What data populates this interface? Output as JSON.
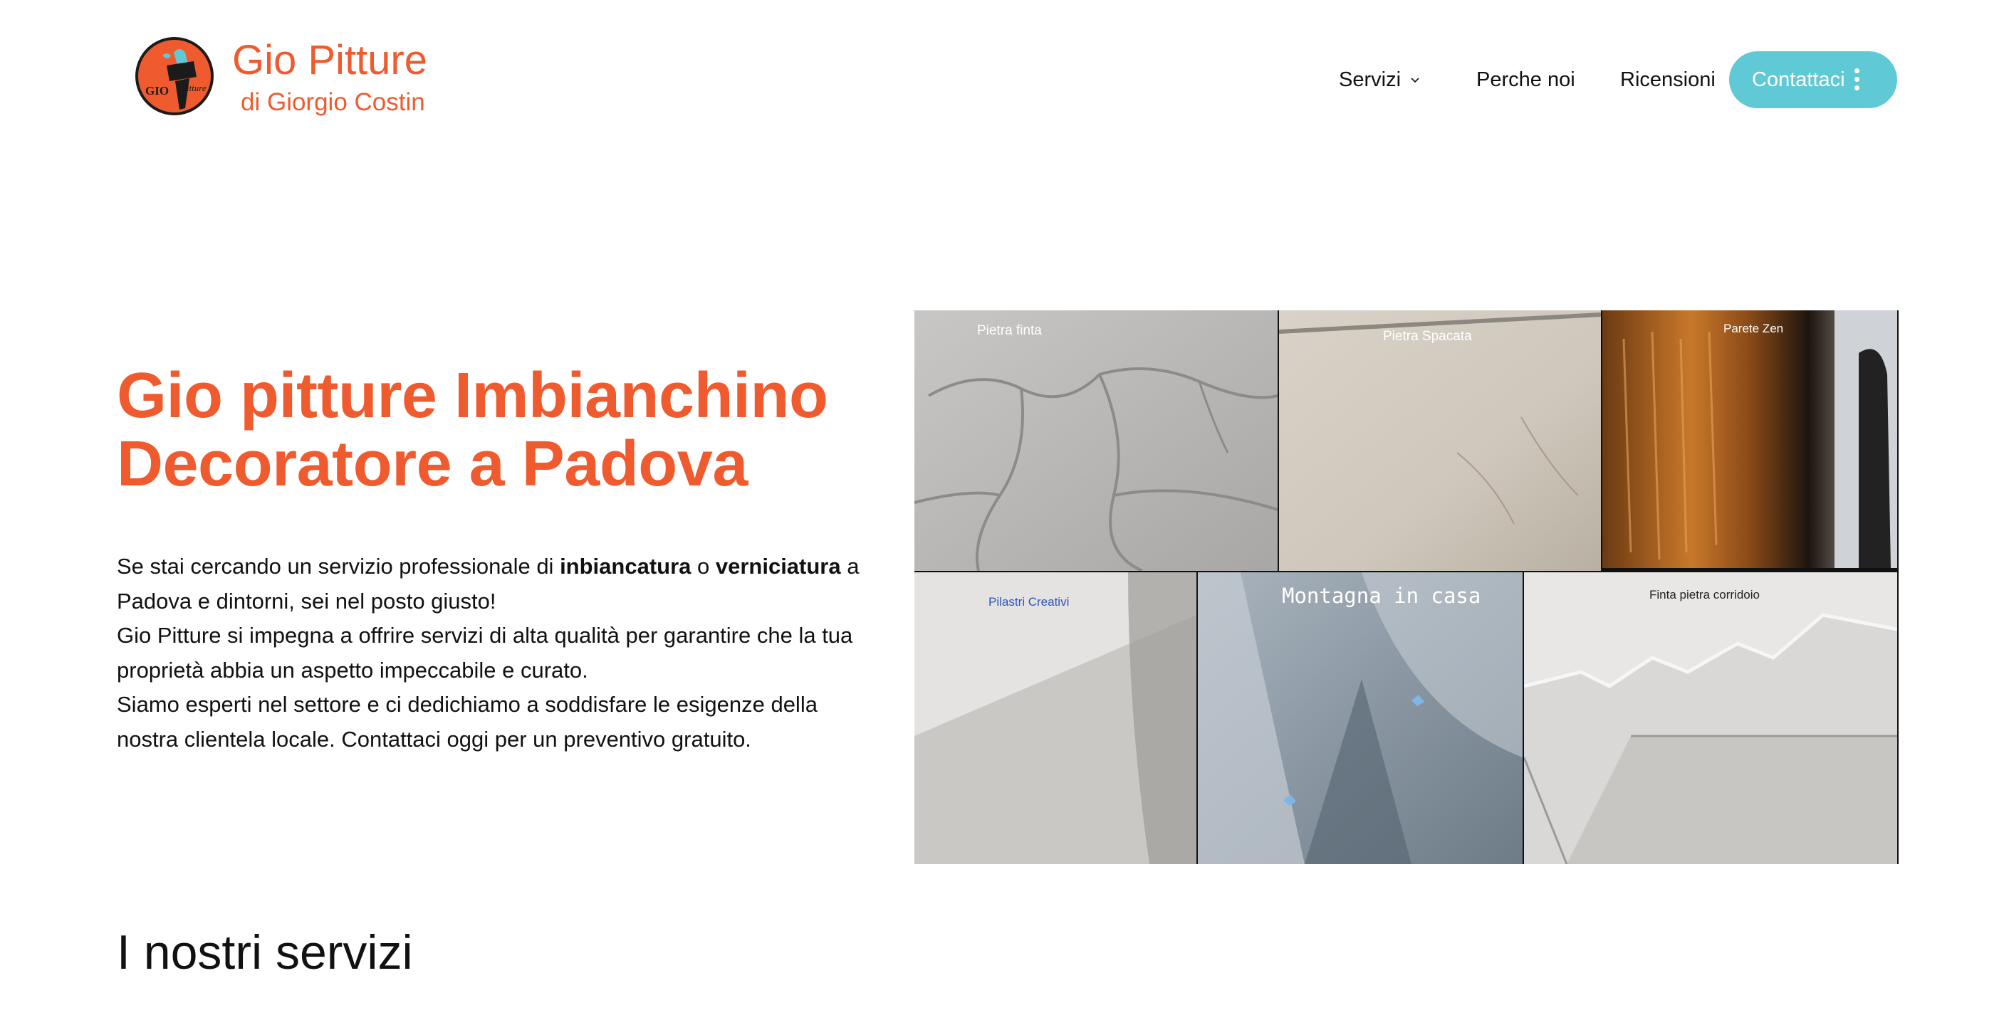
{
  "brand": {
    "title": "Gio Pitture",
    "subtitle": "di Giorgio Costin",
    "logo_text_main": "GIO",
    "logo_text_script": "Pitture",
    "color": "#ef5b2e"
  },
  "nav": {
    "items": [
      {
        "label": "Servizi",
        "has_dropdown": true
      },
      {
        "label": "Perche noi"
      },
      {
        "label": "Ricensioni"
      }
    ],
    "cta_label": "Contattaci",
    "cta_color": "#5fcad6"
  },
  "hero": {
    "title": "Gio pitture Imbianchino Decoratore a Padova",
    "p1_a": "Se stai cercando un servizio professionale di ",
    "p1_b": "inbiancatura",
    "p1_c": " o ",
    "p1_d": "verniciatura",
    "p1_e": " a Padova e dintorni, sei nel posto giusto!",
    "p2": "Gio Pitture si impegna a offrire servizi di alta qualità per garantire che la tua proprietà abbia un aspetto impeccabile e curato.",
    "p3": "Siamo esperti nel settore e ci dedichiamo a soddisfare le esigenze della nostra clientela locale. Contattaci oggi per un preventivo gratuito."
  },
  "collage": {
    "tiles": [
      {
        "label": "Pietra finta"
      },
      {
        "label": "Pietra Spacata"
      },
      {
        "label": "Parete Zen"
      },
      {
        "label": "Pilastri Creativi"
      },
      {
        "label": "Montagna in casa"
      },
      {
        "label": "Finta pietra corridoio"
      }
    ]
  },
  "services": {
    "title": "I nostri servizi"
  }
}
